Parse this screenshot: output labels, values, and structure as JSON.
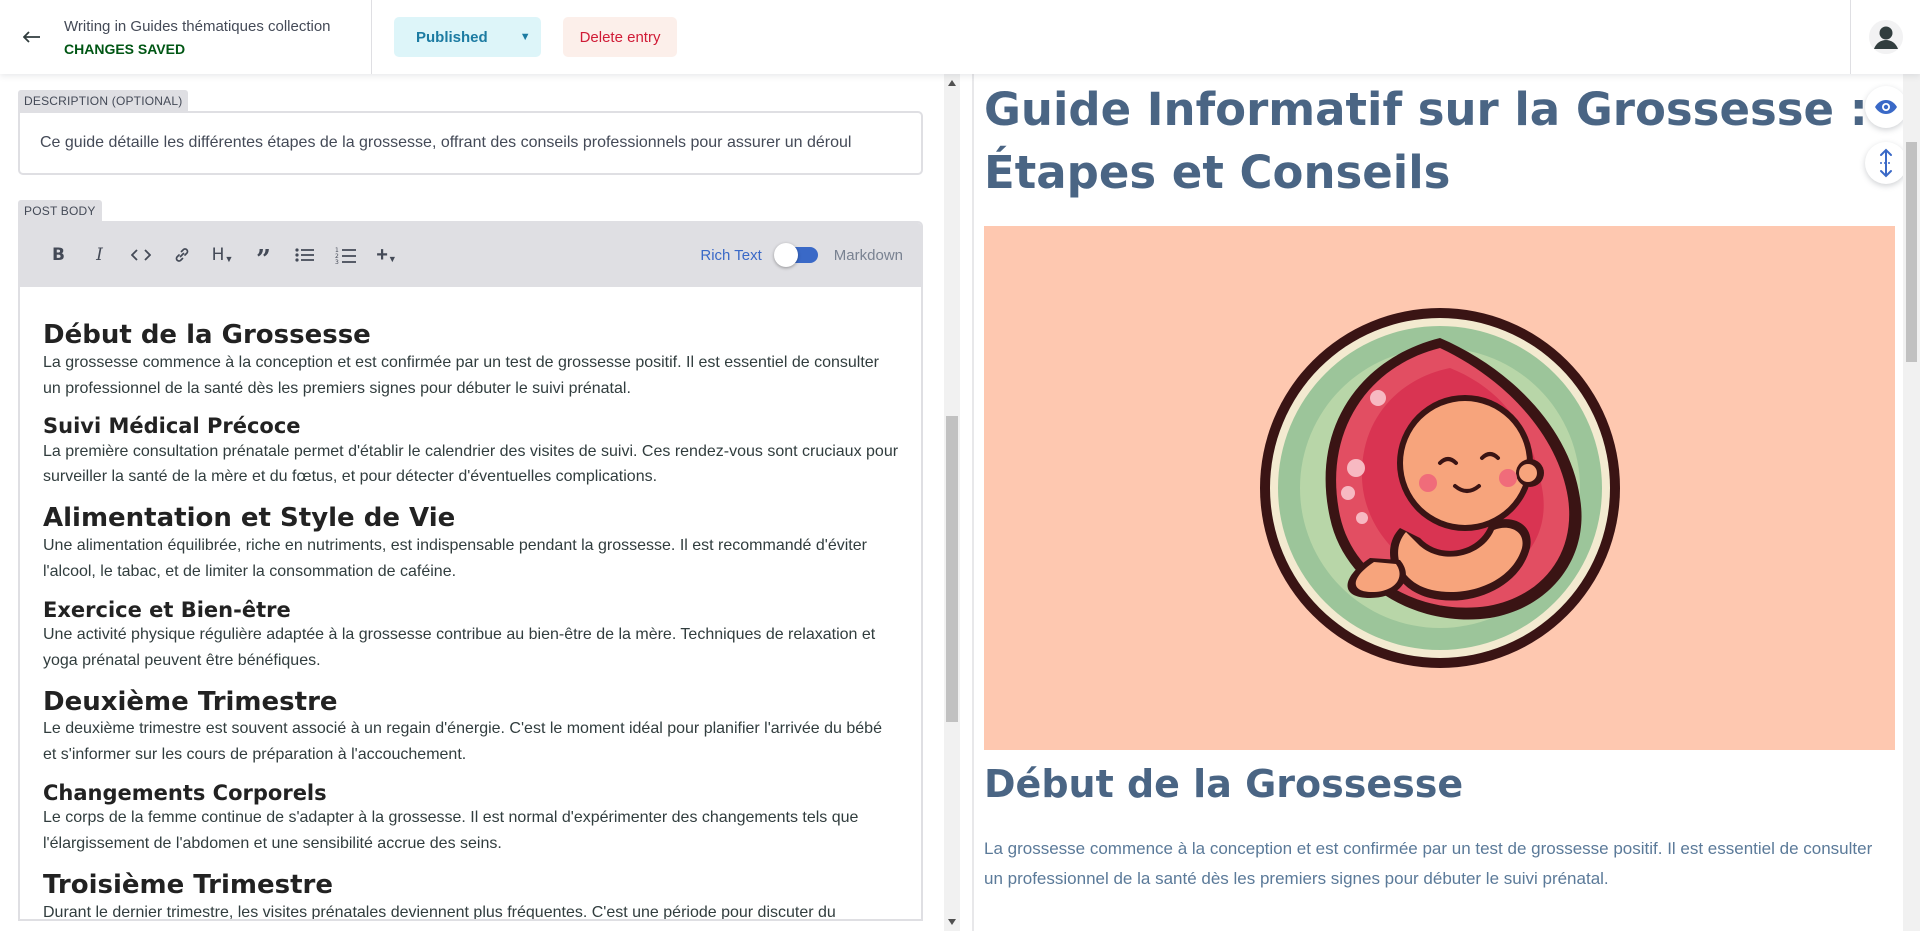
{
  "header": {
    "back_icon": "arrow-left-icon",
    "title": "Writing in Guides thématiques collection",
    "status": "CHANGES SAVED",
    "publish_label": "Published",
    "delete_label": "Delete entry",
    "user_icon": "user-avatar-icon"
  },
  "editor": {
    "description": {
      "label": "DESCRIPTION (OPTIONAL)",
      "value": "Ce guide détaille les différentes étapes de la grossesse, offrant des conseils professionnels pour assurer un déroul"
    },
    "body": {
      "label": "POST BODY",
      "toolbar": {
        "buttons": [
          "bold-icon",
          "italic-icon",
          "code-icon",
          "link-icon",
          "heading-icon",
          "quote-icon",
          "bulleted-list-icon",
          "numbered-list-icon",
          "add-component-icon"
        ],
        "rich_text_label": "Rich Text",
        "markdown_label": "Markdown"
      },
      "sections": [
        {
          "level": "h3",
          "title": "Début de la Grossesse",
          "text": "La grossesse commence à la conception et est confirmée par un test de grossesse positif. Il est essentiel de consulter un professionnel de la santé dès les premiers signes pour débuter le suivi prénatal."
        },
        {
          "level": "h4",
          "title": "Suivi Médical Précoce",
          "text": "La première consultation prénatale permet d'établir le calendrier des visites de suivi. Ces rendez-vous sont cruciaux pour surveiller la santé de la mère et du fœtus, et pour détecter d'éventuelles complications."
        },
        {
          "level": "h3",
          "title": "Alimentation et Style de Vie",
          "text": "Une alimentation équilibrée, riche en nutriments, est indispensable pendant la grossesse. Il est recommandé d'éviter l'alcool, le tabac, et de limiter la consommation de caféine."
        },
        {
          "level": "h4",
          "title": "Exercice et Bien-être",
          "text": "Une activité physique régulière adaptée à la grossesse contribue au bien-être de la mère. Techniques de relaxation et yoga prénatal peuvent être bénéfiques."
        },
        {
          "level": "h3",
          "title": "Deuxième Trimestre",
          "text": "Le deuxième trimestre est souvent associé à un regain d'énergie. C'est le moment idéal pour planifier l'arrivée du bébé et s'informer sur les cours de préparation à l'accouchement."
        },
        {
          "level": "h4",
          "title": "Changements Corporels",
          "text": "Le corps de la femme continue de s'adapter à la grossesse. Il est normal d'expérimenter des changements tels que l'élargissement de l'abdomen et une sensibilité accrue des seins."
        },
        {
          "level": "h3",
          "title": "Troisième Trimestre",
          "text": "Durant le dernier trimestre, les visites prénatales deviennent plus fréquentes. C'est une période pour discuter du"
        }
      ]
    }
  },
  "preview": {
    "title": "Guide Informatif sur la Grossesse : Étapes et Conseils",
    "image_icon": "fetus-illustration",
    "section_title": "Début de la Grossesse",
    "section_text": "La grossesse commence à la conception et est confirmée par un test de grossesse positif. Il est essentiel de consulter un professionnel de la santé dès les premiers signes pour débuter le suivi prénatal.",
    "toggle_preview_icon": "eye-icon",
    "sync_scroll_icon": "vertical-arrows-icon"
  },
  "colors": {
    "accent": "#3a69c7",
    "saved": "#005614",
    "delete": "#d01b36",
    "preview_heading": "#4a6584",
    "image_bg": "#fec8b0"
  }
}
